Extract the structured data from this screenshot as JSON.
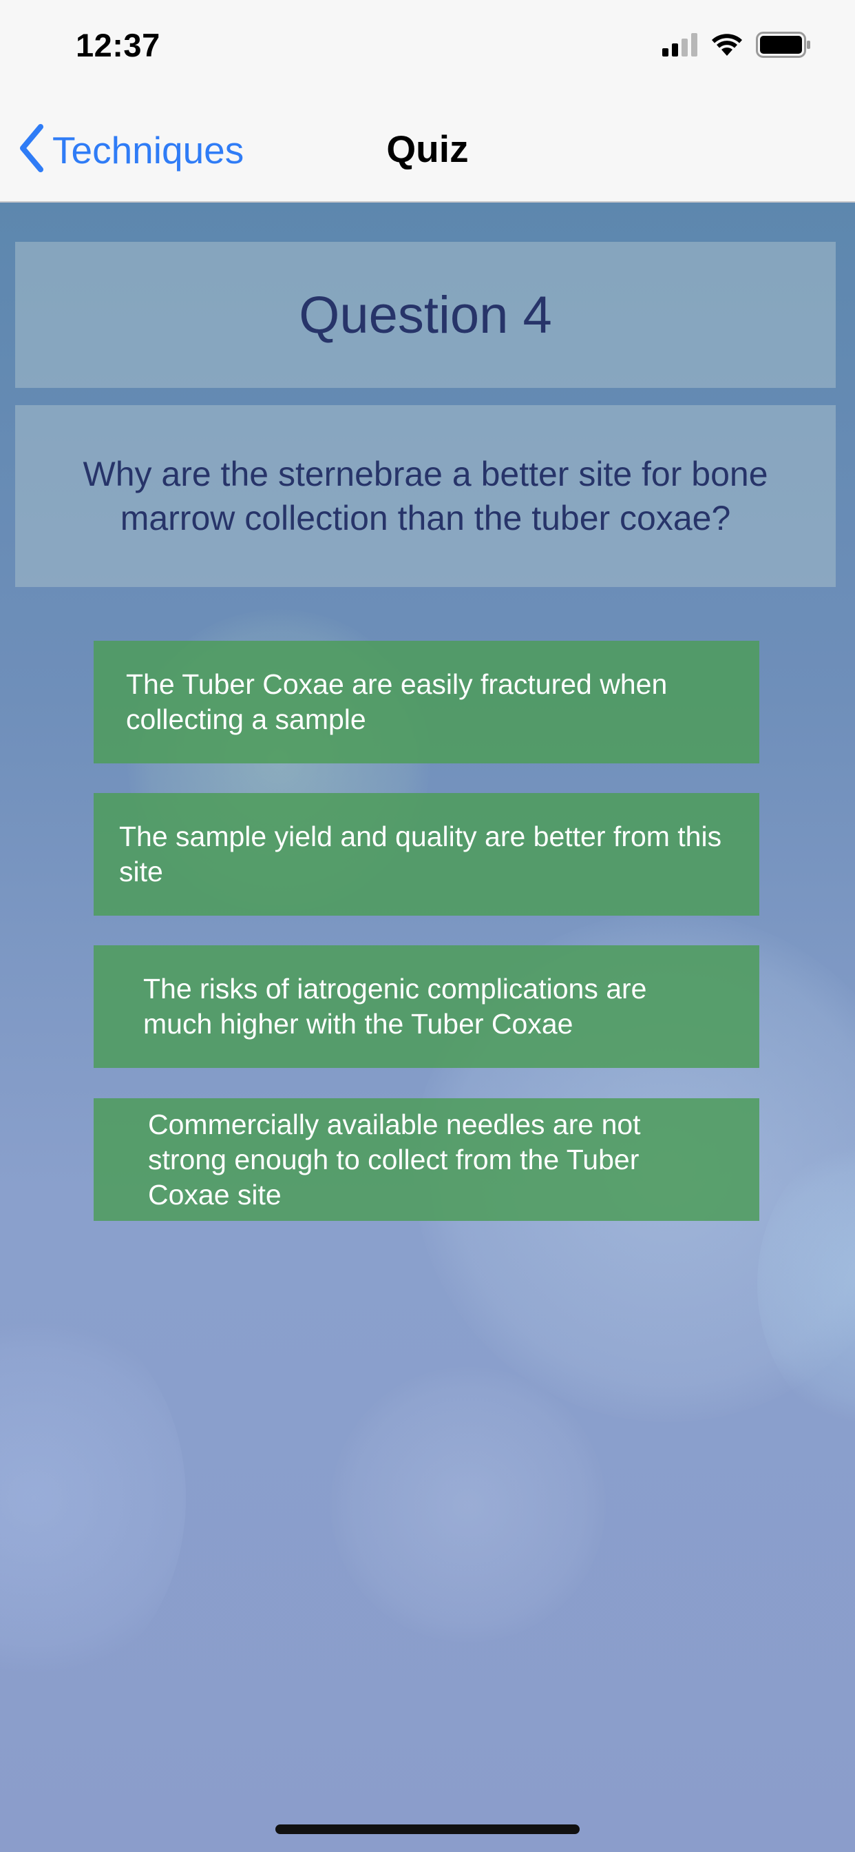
{
  "status_bar": {
    "time": "12:37"
  },
  "nav": {
    "back_label": "Techniques",
    "title": "Quiz"
  },
  "quiz": {
    "question_label": "Question 4",
    "question_text": "Why are the sternebrae a better site for bone marrow collection than the tuber coxae?",
    "answers": [
      {
        "text": "The Tuber Coxae are easily fractured when collecting a sample"
      },
      {
        "text": "The sample yield and quality are better from this site"
      },
      {
        "text": "The risks of iatrogenic complications are much higher with the Tuber Coxae"
      },
      {
        "text": "Commercially available needles are not strong enough to collect from the Tuber Coxae site"
      }
    ]
  },
  "colors": {
    "accent": "#2f7cf6",
    "answer_bg": "#4e9c5a",
    "question_text": "#273469"
  },
  "icons": {
    "back": "chevron-left-icon",
    "signal": "cellular-signal-icon",
    "wifi": "wifi-icon",
    "battery": "battery-icon"
  }
}
